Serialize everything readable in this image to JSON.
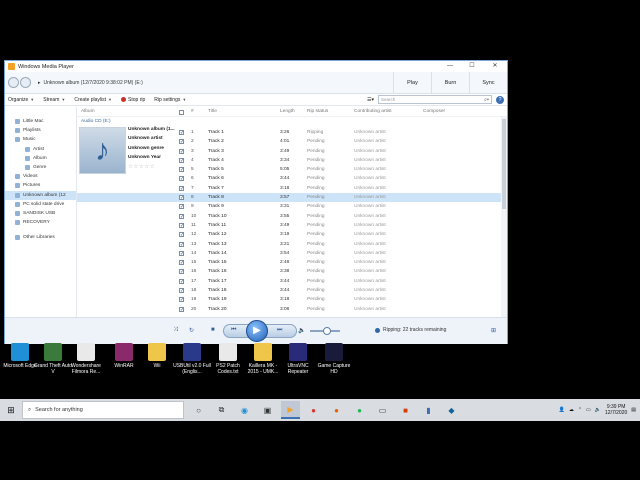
{
  "window": {
    "title": "Windows Media Player",
    "controls": {
      "minimize": "—",
      "maximize": "☐",
      "close": "✕"
    }
  },
  "nav": {
    "breadcrumb": "Unknown album (12/7/2020 9:38:02 PM) (E:)",
    "tabs": [
      "Play",
      "Burn",
      "Sync"
    ]
  },
  "toolbar": {
    "organize": "Organize",
    "stream": "Stream",
    "create_playlist": "Create playlist",
    "stop_rip": "Stop rip",
    "rip_settings": "Rip settings",
    "search_placeholder": "Search"
  },
  "sidebar": {
    "items": [
      {
        "label": "Little Mac",
        "level": 0
      },
      {
        "label": "Playlists",
        "level": 0
      },
      {
        "label": "Music",
        "level": 0
      },
      {
        "label": "Artist",
        "level": 1
      },
      {
        "label": "Album",
        "level": 1
      },
      {
        "label": "Genre",
        "level": 1
      },
      {
        "label": "Videos",
        "level": 0
      },
      {
        "label": "Pictures",
        "level": 0
      },
      {
        "label": "Unknown album (12",
        "level": 0,
        "selected": true
      },
      {
        "label": "PC solid state drive",
        "level": 0
      },
      {
        "label": "SANDISK USB",
        "level": 0
      },
      {
        "label": "RECOVERY",
        "level": 0
      }
    ],
    "other_libraries": "Other Libraries"
  },
  "columns": {
    "album": "Album",
    "num": "#",
    "title": "Title",
    "length": "Length",
    "rip_status": "Rip status",
    "contributing_artist": "Contributing artist",
    "composer": "Composer"
  },
  "album": {
    "group": "Audio CD (E:)",
    "name": "Unknown album (1...",
    "artist": "Unknown artist",
    "genre": "Unknown genre",
    "year": "Unknown Year",
    "rating": "☆☆☆☆☆"
  },
  "tracks": [
    {
      "num": "1",
      "title": "Track 1",
      "length": "3:26",
      "status": "Ripping",
      "artist": "Unknown artist"
    },
    {
      "num": "2",
      "title": "Track 2",
      "length": "4:01",
      "status": "Pending",
      "artist": "Unknown artist"
    },
    {
      "num": "3",
      "title": "Track 3",
      "length": "3:49",
      "status": "Pending",
      "artist": "Unknown artist"
    },
    {
      "num": "4",
      "title": "Track 4",
      "length": "3:34",
      "status": "Pending",
      "artist": "Unknown artist"
    },
    {
      "num": "5",
      "title": "Track 5",
      "length": "5:05",
      "status": "Pending",
      "artist": "Unknown artist"
    },
    {
      "num": "6",
      "title": "Track 6",
      "length": "3:44",
      "status": "Pending",
      "artist": "Unknown artist"
    },
    {
      "num": "7",
      "title": "Track 7",
      "length": "3:18",
      "status": "Pending",
      "artist": "Unknown artist"
    },
    {
      "num": "8",
      "title": "Track 8",
      "length": "3:57",
      "status": "Pending",
      "artist": "Unknown artist",
      "selected": true
    },
    {
      "num": "9",
      "title": "Track 9",
      "length": "3:31",
      "status": "Pending",
      "artist": "Unknown artist"
    },
    {
      "num": "10",
      "title": "Track 10",
      "length": "3:55",
      "status": "Pending",
      "artist": "Unknown artist"
    },
    {
      "num": "11",
      "title": "Track 11",
      "length": "3:49",
      "status": "Pending",
      "artist": "Unknown artist"
    },
    {
      "num": "12",
      "title": "Track 12",
      "length": "3:19",
      "status": "Pending",
      "artist": "Unknown artist"
    },
    {
      "num": "13",
      "title": "Track 13",
      "length": "3:21",
      "status": "Pending",
      "artist": "Unknown artist"
    },
    {
      "num": "14",
      "title": "Track 14",
      "length": "3:54",
      "status": "Pending",
      "artist": "Unknown artist"
    },
    {
      "num": "15",
      "title": "Track 15",
      "length": "2:46",
      "status": "Pending",
      "artist": "Unknown artist"
    },
    {
      "num": "16",
      "title": "Track 16",
      "length": "3:38",
      "status": "Pending",
      "artist": "Unknown artist"
    },
    {
      "num": "17",
      "title": "Track 17",
      "length": "3:44",
      "status": "Pending",
      "artist": "Unknown artist"
    },
    {
      "num": "18",
      "title": "Track 18",
      "length": "3:44",
      "status": "Pending",
      "artist": "Unknown artist"
    },
    {
      "num": "19",
      "title": "Track 19",
      "length": "3:18",
      "status": "Pending",
      "artist": "Unknown artist"
    },
    {
      "num": "20",
      "title": "Track 20",
      "length": "3:06",
      "status": "Pending",
      "artist": "Unknown artist"
    }
  ],
  "player": {
    "rip_status": "Ripping: 22 tracks remaining"
  },
  "desktop_icons": [
    {
      "label": "Microsoft Edge",
      "color": "#1f8fd6"
    },
    {
      "label": "Grand Theft Auto V",
      "color": "#3a7a3a"
    },
    {
      "label": "Wondershare Filmora Re...",
      "color": "#e9e9e9"
    },
    {
      "label": "WinRAR",
      "color": "#8a2a6a"
    },
    {
      "label": "Wii",
      "color": "#f0c64a"
    },
    {
      "label": "USBUtil v2.0 Full (Englis...",
      "color": "#2a3a8a"
    },
    {
      "label": "PS2 Patch Codes.txt",
      "color": "#e9e9e9"
    },
    {
      "label": "Kaillera MK - 2015 - UMK...",
      "color": "#f0c64a"
    },
    {
      "label": "UltraVNC Repeater",
      "color": "#2a2a7a"
    },
    {
      "label": "Game Capture HD",
      "color": "#1a1a3a"
    }
  ],
  "taskbar": {
    "search_placeholder": "Search for anything",
    "time": "9:39 PM",
    "date": "12/7/2020"
  }
}
